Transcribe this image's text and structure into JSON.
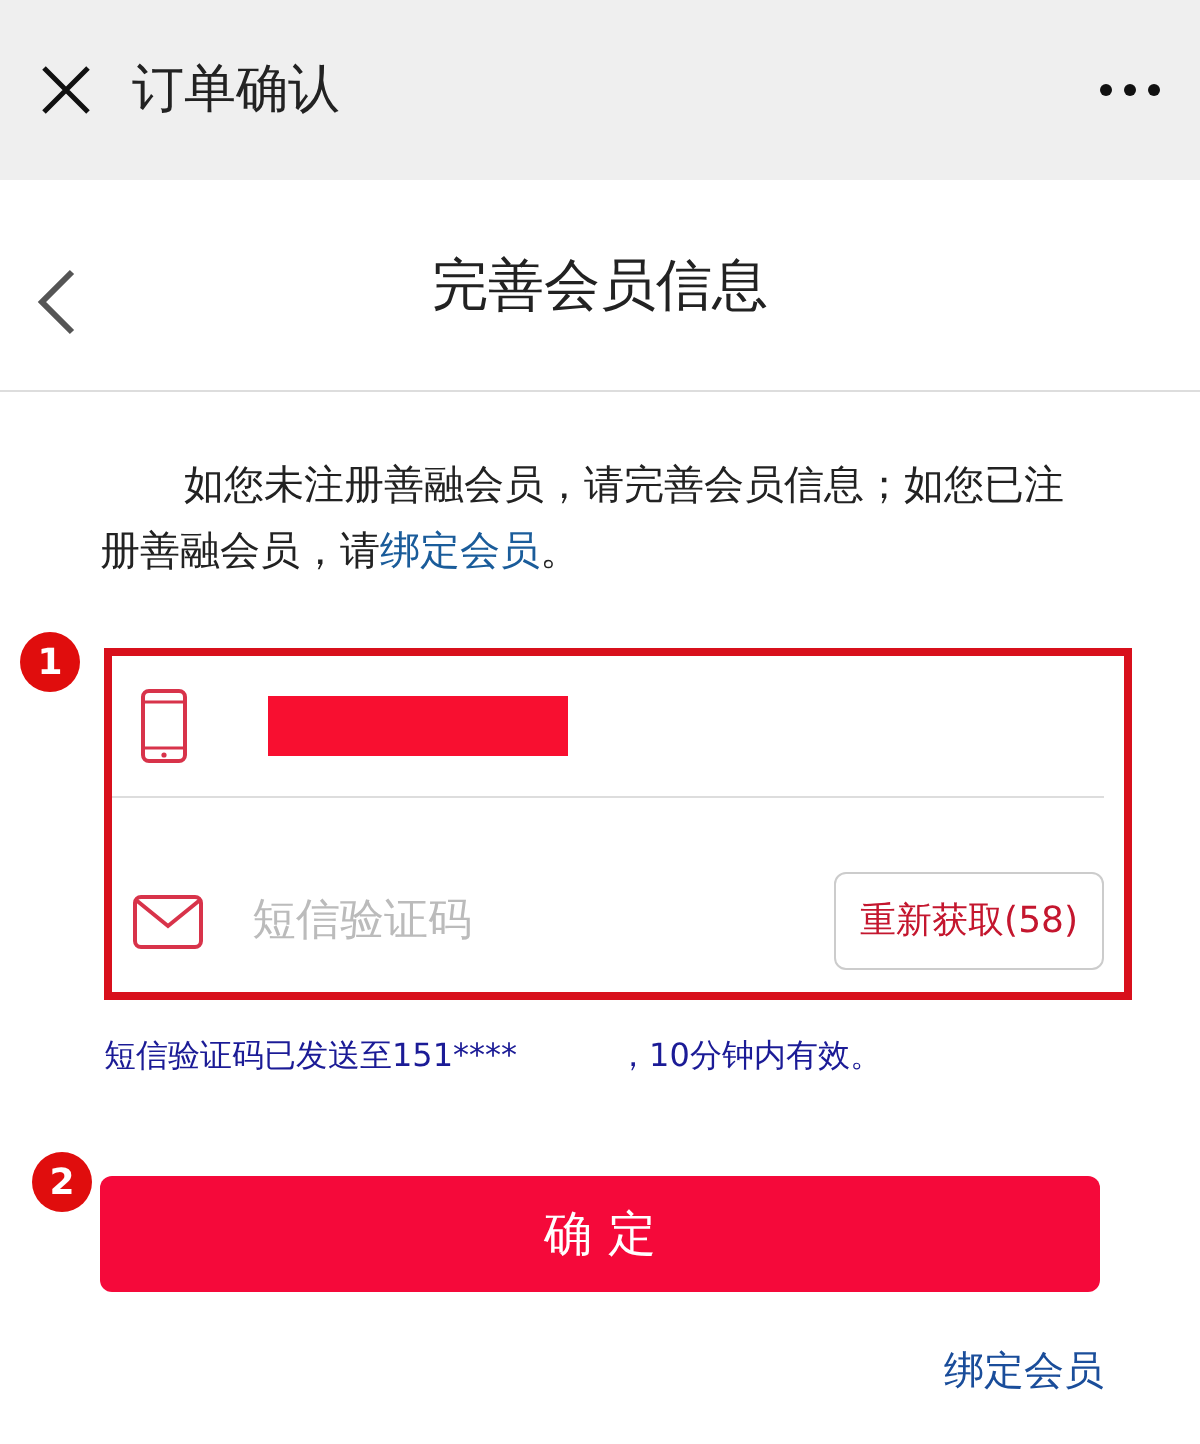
{
  "top_bar": {
    "title": "订单确认"
  },
  "header": {
    "title": "完善会员信息"
  },
  "intro": {
    "text": "如您未注册善融会员，请完善会员信息；如您已注册善融会员，请",
    "link": "绑定会员",
    "after": "。"
  },
  "form": {
    "phone_redacted": true,
    "code_placeholder": "短信验证码",
    "resend_button": "重新获取(58)"
  },
  "sms_hint": {
    "before": "短信验证码已发送至151****",
    "after": "，10分钟内有效。"
  },
  "confirm_button": "确 定",
  "bottom_link": "绑定会员",
  "callouts": [
    "1",
    "2"
  ]
}
